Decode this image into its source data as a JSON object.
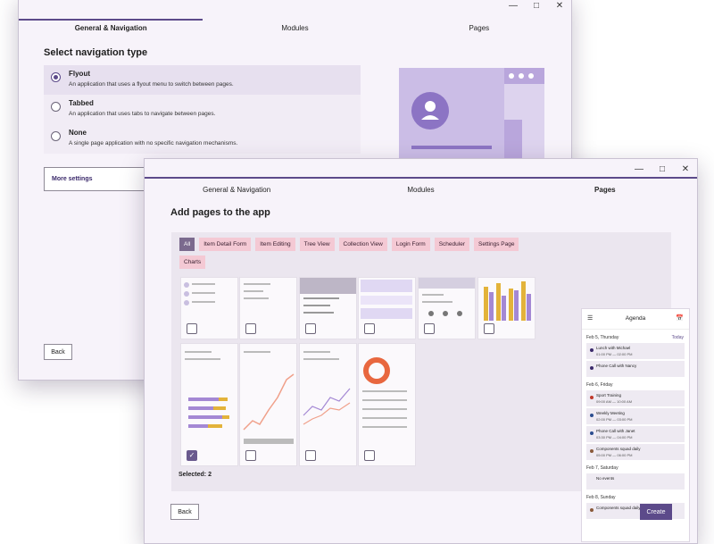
{
  "back_window": {
    "tabs": [
      "General & Navigation",
      "Modules",
      "Pages"
    ],
    "heading": "Select navigation type",
    "options": [
      {
        "title": "Flyout",
        "description": "An application that uses a flyout menu to switch between pages."
      },
      {
        "title": "Tabbed",
        "description": "An application that uses tabs to navigate between pages."
      },
      {
        "title": "None",
        "description": "A single page application with no specific navigation mechanisms."
      }
    ],
    "more_settings_label": "More settings",
    "back_label": "Back"
  },
  "front_window": {
    "tabs": [
      "General & Navigation",
      "Modules",
      "Pages"
    ],
    "heading": "Add pages to the app",
    "chips": [
      "All",
      "Item Detail Form",
      "Item Editing",
      "Tree View",
      "Collection View",
      "Login Form",
      "Scheduler",
      "Settings Page",
      "Charts"
    ],
    "selected_label": "Selected: 2",
    "back_label": "Back",
    "create_label": "Create",
    "agenda": {
      "title": "Agenda",
      "days": [
        {
          "date": "Feb 5, Thursday",
          "extra": "Today",
          "items": [
            {
              "title": "Lunch with Michael",
              "time": "01:00 PM — 02:00 PM",
              "color": "#3b2a6b"
            },
            {
              "title": "Phone Call with Nancy",
              "time": "",
              "color": "#3b2a6b"
            }
          ]
        },
        {
          "date": "Feb 6, Friday",
          "extra": "",
          "items": [
            {
              "title": "Sport Training",
              "time": "09:00 AM — 10:00 AM",
              "color": "#c0392b"
            },
            {
              "title": "Weekly Meeting",
              "time": "02:00 PM — 03:00 PM",
              "color": "#2b4d8f"
            },
            {
              "title": "Phone Call with Janet",
              "time": "03:30 PM — 04:00 PM",
              "color": "#2b4d8f"
            },
            {
              "title": "Components squad daily",
              "time": "05:00 PM — 06:00 PM",
              "color": "#8a5a3a"
            }
          ]
        },
        {
          "date": "Feb 7, Saturday",
          "extra": "",
          "items": [
            {
              "title": "No events",
              "time": "",
              "color": "#eeeaf2"
            }
          ]
        },
        {
          "date": "Feb 8, Sunday",
          "extra": "",
          "items": [
            {
              "title": "Components squad daily",
              "time": "",
              "color": "#8a5a3a"
            }
          ]
        }
      ]
    }
  }
}
